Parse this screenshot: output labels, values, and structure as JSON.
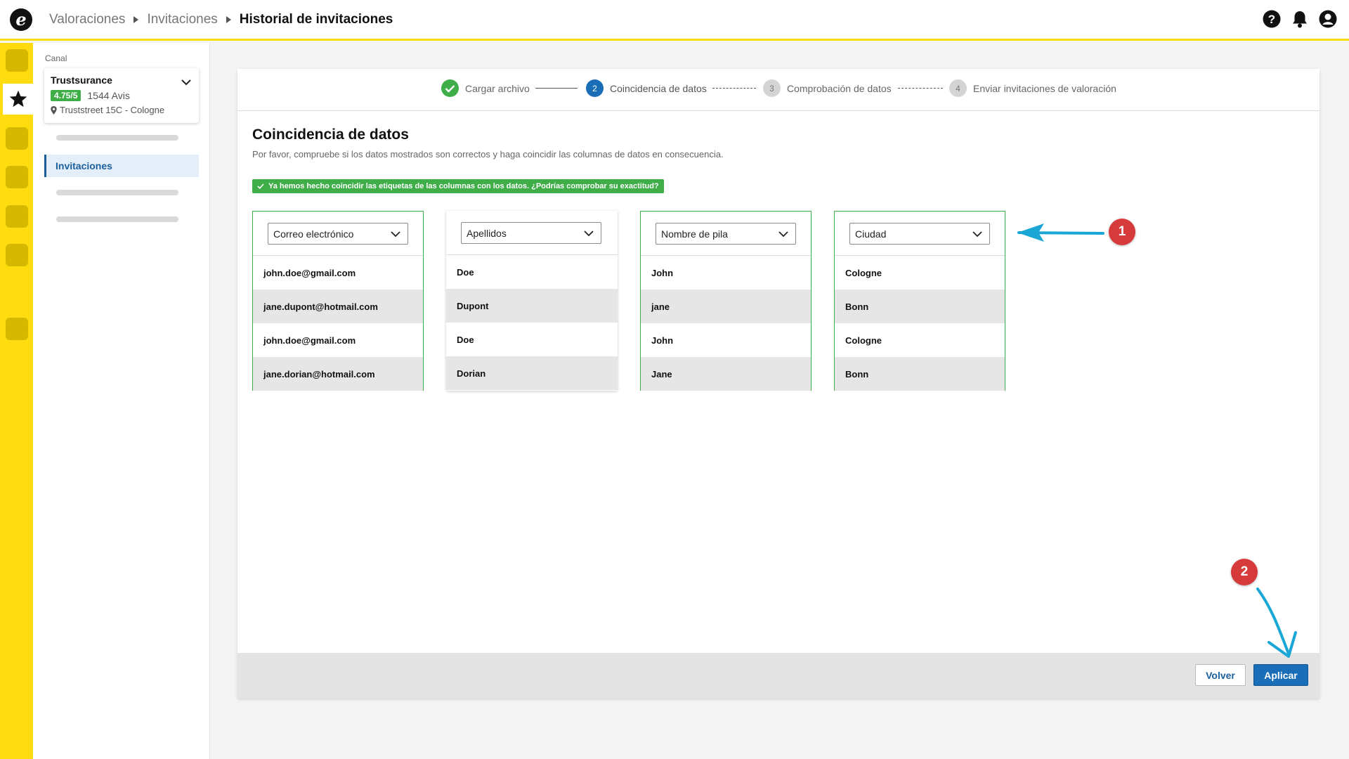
{
  "header": {
    "breadcrumb": [
      "Valoraciones",
      "Invitaciones"
    ],
    "current": "Historial de invitaciones",
    "icons": [
      "help-icon",
      "bell-icon",
      "account-icon"
    ]
  },
  "sidebar": {
    "canal_label": "Canal",
    "channel": {
      "name": "Trustsurance",
      "rating": "4.75/5",
      "reviews": "1544 Avis",
      "address": "Truststreet 15C - Cologne"
    },
    "active_item": "Invitaciones"
  },
  "stepper": {
    "steps": [
      {
        "number": "",
        "label": "Cargar archivo",
        "state": "done"
      },
      {
        "number": "2",
        "label": "Coincidencia de datos",
        "state": "active"
      },
      {
        "number": "3",
        "label": "Comprobación de datos",
        "state": "todo"
      },
      {
        "number": "4",
        "label": "Enviar invitaciones de valoración",
        "state": "todo"
      }
    ]
  },
  "main": {
    "title": "Coincidencia de datos",
    "subtitle": "Por favor, compruebe si los datos mostrados son correctos y haga coincidir las columnas de datos en consecuencia.",
    "banner": "Ya hemos hecho coincidir las etiquetas de las columnas con los datos. ¿Podrías comprobar su exactitud?",
    "columns": [
      {
        "header": "Correo electrónico",
        "values": [
          "john.doe@gmail.com",
          "jane.dupont@hotmail.com",
          "john.doe@gmail.com",
          "jane.dorian@hotmail.com"
        ]
      },
      {
        "header": "Apellidos",
        "values": [
          "Doe",
          "Dupont",
          "Doe",
          "Dorian"
        ]
      },
      {
        "header": "Nombre de pila",
        "values": [
          "John",
          "jane",
          "John",
          "Jane"
        ]
      },
      {
        "header": "Ciudad",
        "values": [
          "Cologne",
          "Bonn",
          "Cologne",
          "Bonn"
        ]
      }
    ]
  },
  "footer": {
    "back_label": "Volver",
    "apply_label": "Aplicar"
  },
  "annotations": {
    "badge_1": "1",
    "badge_2": "2"
  },
  "colors": {
    "brand_yellow": "#ffdc0f",
    "success_green": "#3fae49",
    "primary_blue": "#1a6eb8",
    "annotation_red": "#d63a3a",
    "annotation_arrow": "#1aa7d6"
  }
}
